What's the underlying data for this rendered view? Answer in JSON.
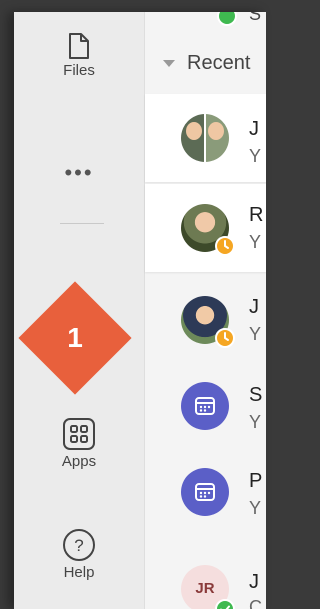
{
  "rail": {
    "files_label": "Files",
    "more_label": "•••",
    "apps_label": "Apps",
    "help_label": "Help",
    "help_glyph": "?"
  },
  "badge": {
    "number": "1",
    "color": "#e8603c"
  },
  "panel": {
    "top_partial_text": "S",
    "recent_header": "Recent",
    "rows": [
      {
        "title": "J",
        "sub": "Y",
        "avatar": "photo-pair",
        "status": "none"
      },
      {
        "title": "R",
        "sub": "Y",
        "avatar": "photo",
        "status": "away"
      },
      {
        "title": "J",
        "sub": "Y",
        "avatar": "photo",
        "status": "away"
      },
      {
        "title": "S",
        "sub": "Y",
        "avatar": "calendar",
        "status": "none"
      },
      {
        "title": "P",
        "sub": "Y",
        "avatar": "calendar",
        "status": "none"
      },
      {
        "title": "J",
        "sub": "C",
        "avatar_initials": "JR",
        "status": "available"
      }
    ]
  },
  "colors": {
    "accent_purple": "#5b5fc7",
    "away": "#f5a623",
    "available": "#3fb950"
  }
}
